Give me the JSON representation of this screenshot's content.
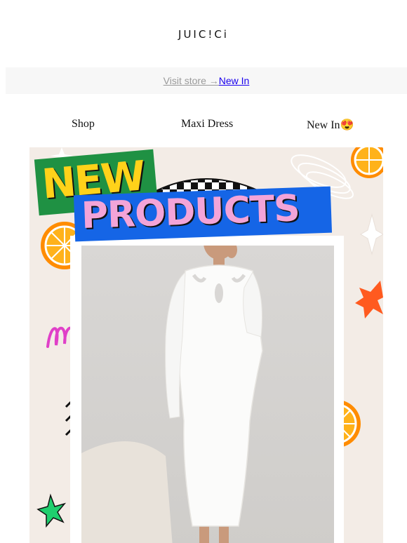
{
  "brand": {
    "logo_text": "JUIC!Ci"
  },
  "store_bar": {
    "visit_label": "Visit store →",
    "new_in_label": "New In"
  },
  "nav": {
    "items": [
      "Shop",
      "Maxi Dress",
      "New In😍"
    ]
  },
  "hero": {
    "badge_new": "NEW",
    "badge_products": "PRODUCTS",
    "colors": {
      "background": "#f3ece6",
      "green": "#1f9143",
      "yellow": "#ffd21a",
      "blue": "#1565e6",
      "pink": "#f3a4d8",
      "orange": "#ff8c00"
    }
  }
}
